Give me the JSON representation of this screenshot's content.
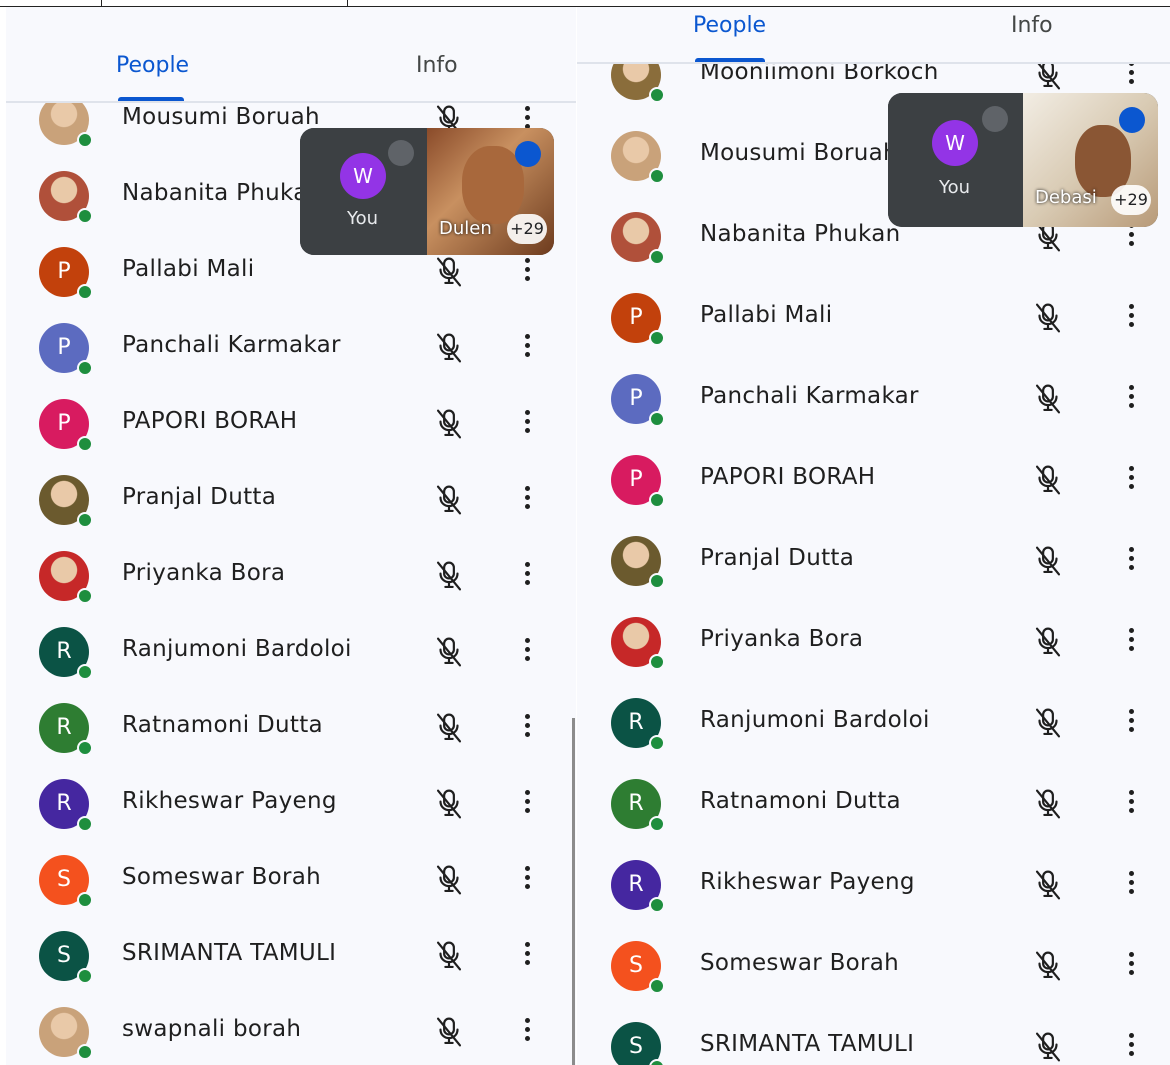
{
  "panels": [
    {
      "tabs": {
        "people": "People",
        "info": "Info"
      },
      "pip": {
        "initial": "W",
        "self_label": "You",
        "speaker": "Dulen",
        "count": "+29"
      },
      "participants": [
        {
          "name": "Mousumi Boruah",
          "avatar": "photo",
          "color": "#c9a27a"
        },
        {
          "name": "Nabanita Phukan",
          "avatar": "photo",
          "color": "#b0503a"
        },
        {
          "name": "Pallabi Mali",
          "initial": "P",
          "color": "#c2410c"
        },
        {
          "name": "Panchali Karmakar",
          "initial": "P",
          "color": "#5c6bc0"
        },
        {
          "name": "PAPORI BORAH",
          "initial": "P",
          "color": "#d81b60"
        },
        {
          "name": "Pranjal Dutta",
          "avatar": "photo",
          "color": "#6b5a2e"
        },
        {
          "name": "Priyanka Bora",
          "avatar": "photo",
          "color": "#c62828"
        },
        {
          "name": "Ranjumoni Bardoloi",
          "initial": "R",
          "color": "#0b5345"
        },
        {
          "name": "Ratnamoni Dutta",
          "initial": "R",
          "color": "#2e7d32"
        },
        {
          "name": "Rikheswar Payeng",
          "initial": "R",
          "color": "#4527a0"
        },
        {
          "name": "Someswar Borah",
          "initial": "S",
          "color": "#f4511e"
        },
        {
          "name": "SRIMANTA TAMULI",
          "initial": "S",
          "color": "#0b5345"
        },
        {
          "name": "swapnali borah",
          "avatar": "photo",
          "color": "#c9a27a"
        }
      ]
    },
    {
      "tabs": {
        "people": "People",
        "info": "Info"
      },
      "pip": {
        "initial": "W",
        "self_label": "You",
        "speaker": "Debasi",
        "count": "+29"
      },
      "participants": [
        {
          "name": "Mooniimoni Borkoch",
          "avatar": "photo",
          "color": "#8a6d3b"
        },
        {
          "name": "Mousumi Boruah",
          "avatar": "photo",
          "color": "#c9a27a"
        },
        {
          "name": "Nabanita Phukan",
          "avatar": "photo",
          "color": "#b0503a"
        },
        {
          "name": "Pallabi Mali",
          "initial": "P",
          "color": "#c2410c"
        },
        {
          "name": "Panchali Karmakar",
          "initial": "P",
          "color": "#5c6bc0"
        },
        {
          "name": "PAPORI BORAH",
          "initial": "P",
          "color": "#d81b60"
        },
        {
          "name": "Pranjal Dutta",
          "avatar": "photo",
          "color": "#6b5a2e"
        },
        {
          "name": "Priyanka Bora",
          "avatar": "photo",
          "color": "#c62828"
        },
        {
          "name": "Ranjumoni Bardoloi",
          "initial": "R",
          "color": "#0b5345"
        },
        {
          "name": "Ratnamoni Dutta",
          "initial": "R",
          "color": "#2e7d32"
        },
        {
          "name": "Rikheswar Payeng",
          "initial": "R",
          "color": "#4527a0"
        },
        {
          "name": "Someswar Borah",
          "initial": "S",
          "color": "#f4511e"
        },
        {
          "name": "SRIMANTA TAMULI",
          "initial": "S",
          "color": "#0b5345"
        }
      ]
    }
  ]
}
